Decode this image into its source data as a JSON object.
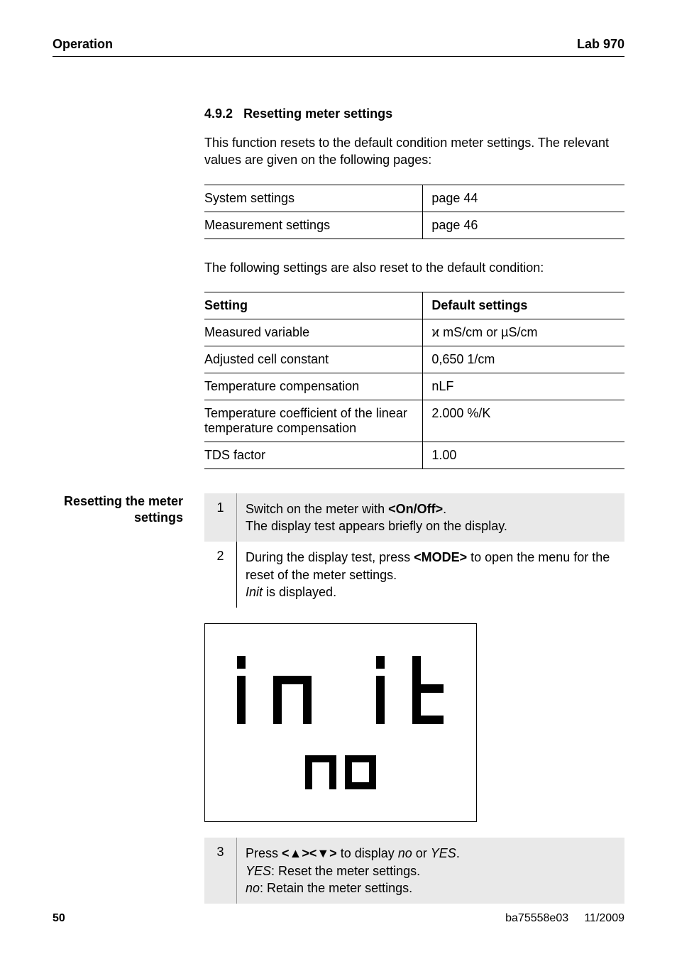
{
  "header": {
    "left": "Operation",
    "right": "Lab 970"
  },
  "section": {
    "number": "4.9.2",
    "title": "Resetting meter settings",
    "intro": "This function resets to the default condition meter settings. The relevant values are given on the following pages:",
    "links": [
      {
        "label": "System settings",
        "page": "page 44"
      },
      {
        "label": "Measurement settings",
        "page": "page 46"
      }
    ],
    "between": "The following settings are also reset to the default condition:",
    "table": {
      "head": {
        "c1": "Setting",
        "c2": "Default settings"
      },
      "rows": [
        {
          "c1": "Measured variable",
          "c2": "ϰ mS/cm or µS/cm"
        },
        {
          "c1": "Adjusted cell constant",
          "c2": "0,650 1/cm"
        },
        {
          "c1": "Temperature compensation",
          "c2": "nLF"
        },
        {
          "c1": "Temperature coefficient of the linear temperature compensation",
          "c2": "2.000 %/K"
        },
        {
          "c1": "TDS factor",
          "c2": "1.00"
        }
      ]
    }
  },
  "side": {
    "line1": "Resetting the meter",
    "line2": "settings"
  },
  "steps": {
    "s1": {
      "num": "1",
      "pre": "Switch on the meter with ",
      "key": "<On/Off>",
      "post": ".",
      "line2": "The display test appears briefly on the display."
    },
    "s2": {
      "num": "2",
      "pre": "During the display test, press ",
      "key": "<MODE>",
      "post": " to open the menu for the reset of the meter settings.",
      "line2a": "Init",
      "line2b": "  is displayed."
    },
    "s3": {
      "num": "3",
      "pre": "Press ",
      "key": "<▲><▼>",
      "mid": " to display ",
      "no": "no",
      "or": " or ",
      "yes": "YES",
      "post": ".",
      "l2a": "YES",
      "l2b": ": Reset the meter settings.",
      "l3a": "no",
      "l3b": ": Retain the meter settings."
    }
  },
  "footer": {
    "page": "50",
    "doc": "ba75558e03",
    "date": "11/2009"
  }
}
